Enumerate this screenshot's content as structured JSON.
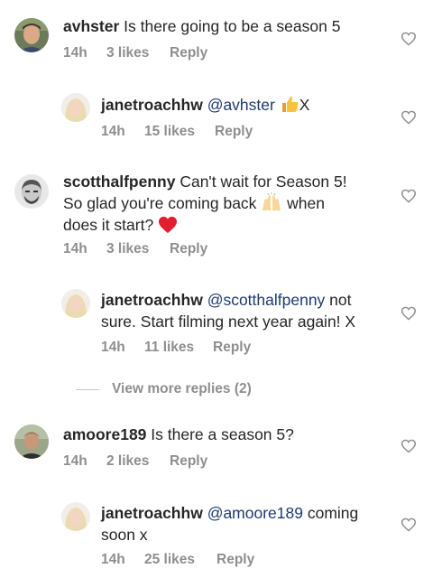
{
  "comments": [
    {
      "username": "avhster",
      "text": " Is there going to be a season 5",
      "time": "14h",
      "likes": "3 likes",
      "reply": "Reply"
    },
    {
      "username": "janetroachhw",
      "mention": "@avhster",
      "text_after": "X",
      "emoji": "thumbs-up",
      "time": "14h",
      "likes": "15 likes",
      "reply": "Reply"
    },
    {
      "username": "scotthalfpenny",
      "text_line1": " Can't wait for Season 5!",
      "text_line2a": "So glad you're coming back ",
      "text_line2b": " when",
      "text_line3": "does it start? ",
      "emoji1": "raised-hands",
      "emoji2": "red-heart",
      "time": "14h",
      "likes": "3 likes",
      "reply": "Reply"
    },
    {
      "username": "janetroachhw",
      "mention": "@scotthalfpenny",
      "text_line1_after": " not",
      "text_line2": "sure. Start filming next year again! X",
      "time": "14h",
      "likes": "11 likes",
      "reply": "Reply"
    },
    {
      "view_more": "View more replies (2)"
    },
    {
      "username": "amoore189",
      "text": " Is there a season 5?",
      "time": "14h",
      "likes": "2 likes",
      "reply": "Reply"
    },
    {
      "username": "janetroachhw",
      "mention": "@amoore189",
      "text_line1_after": " coming",
      "text_line2": "soon x",
      "time": "14h",
      "likes": "25 likes",
      "reply": "Reply"
    }
  ]
}
